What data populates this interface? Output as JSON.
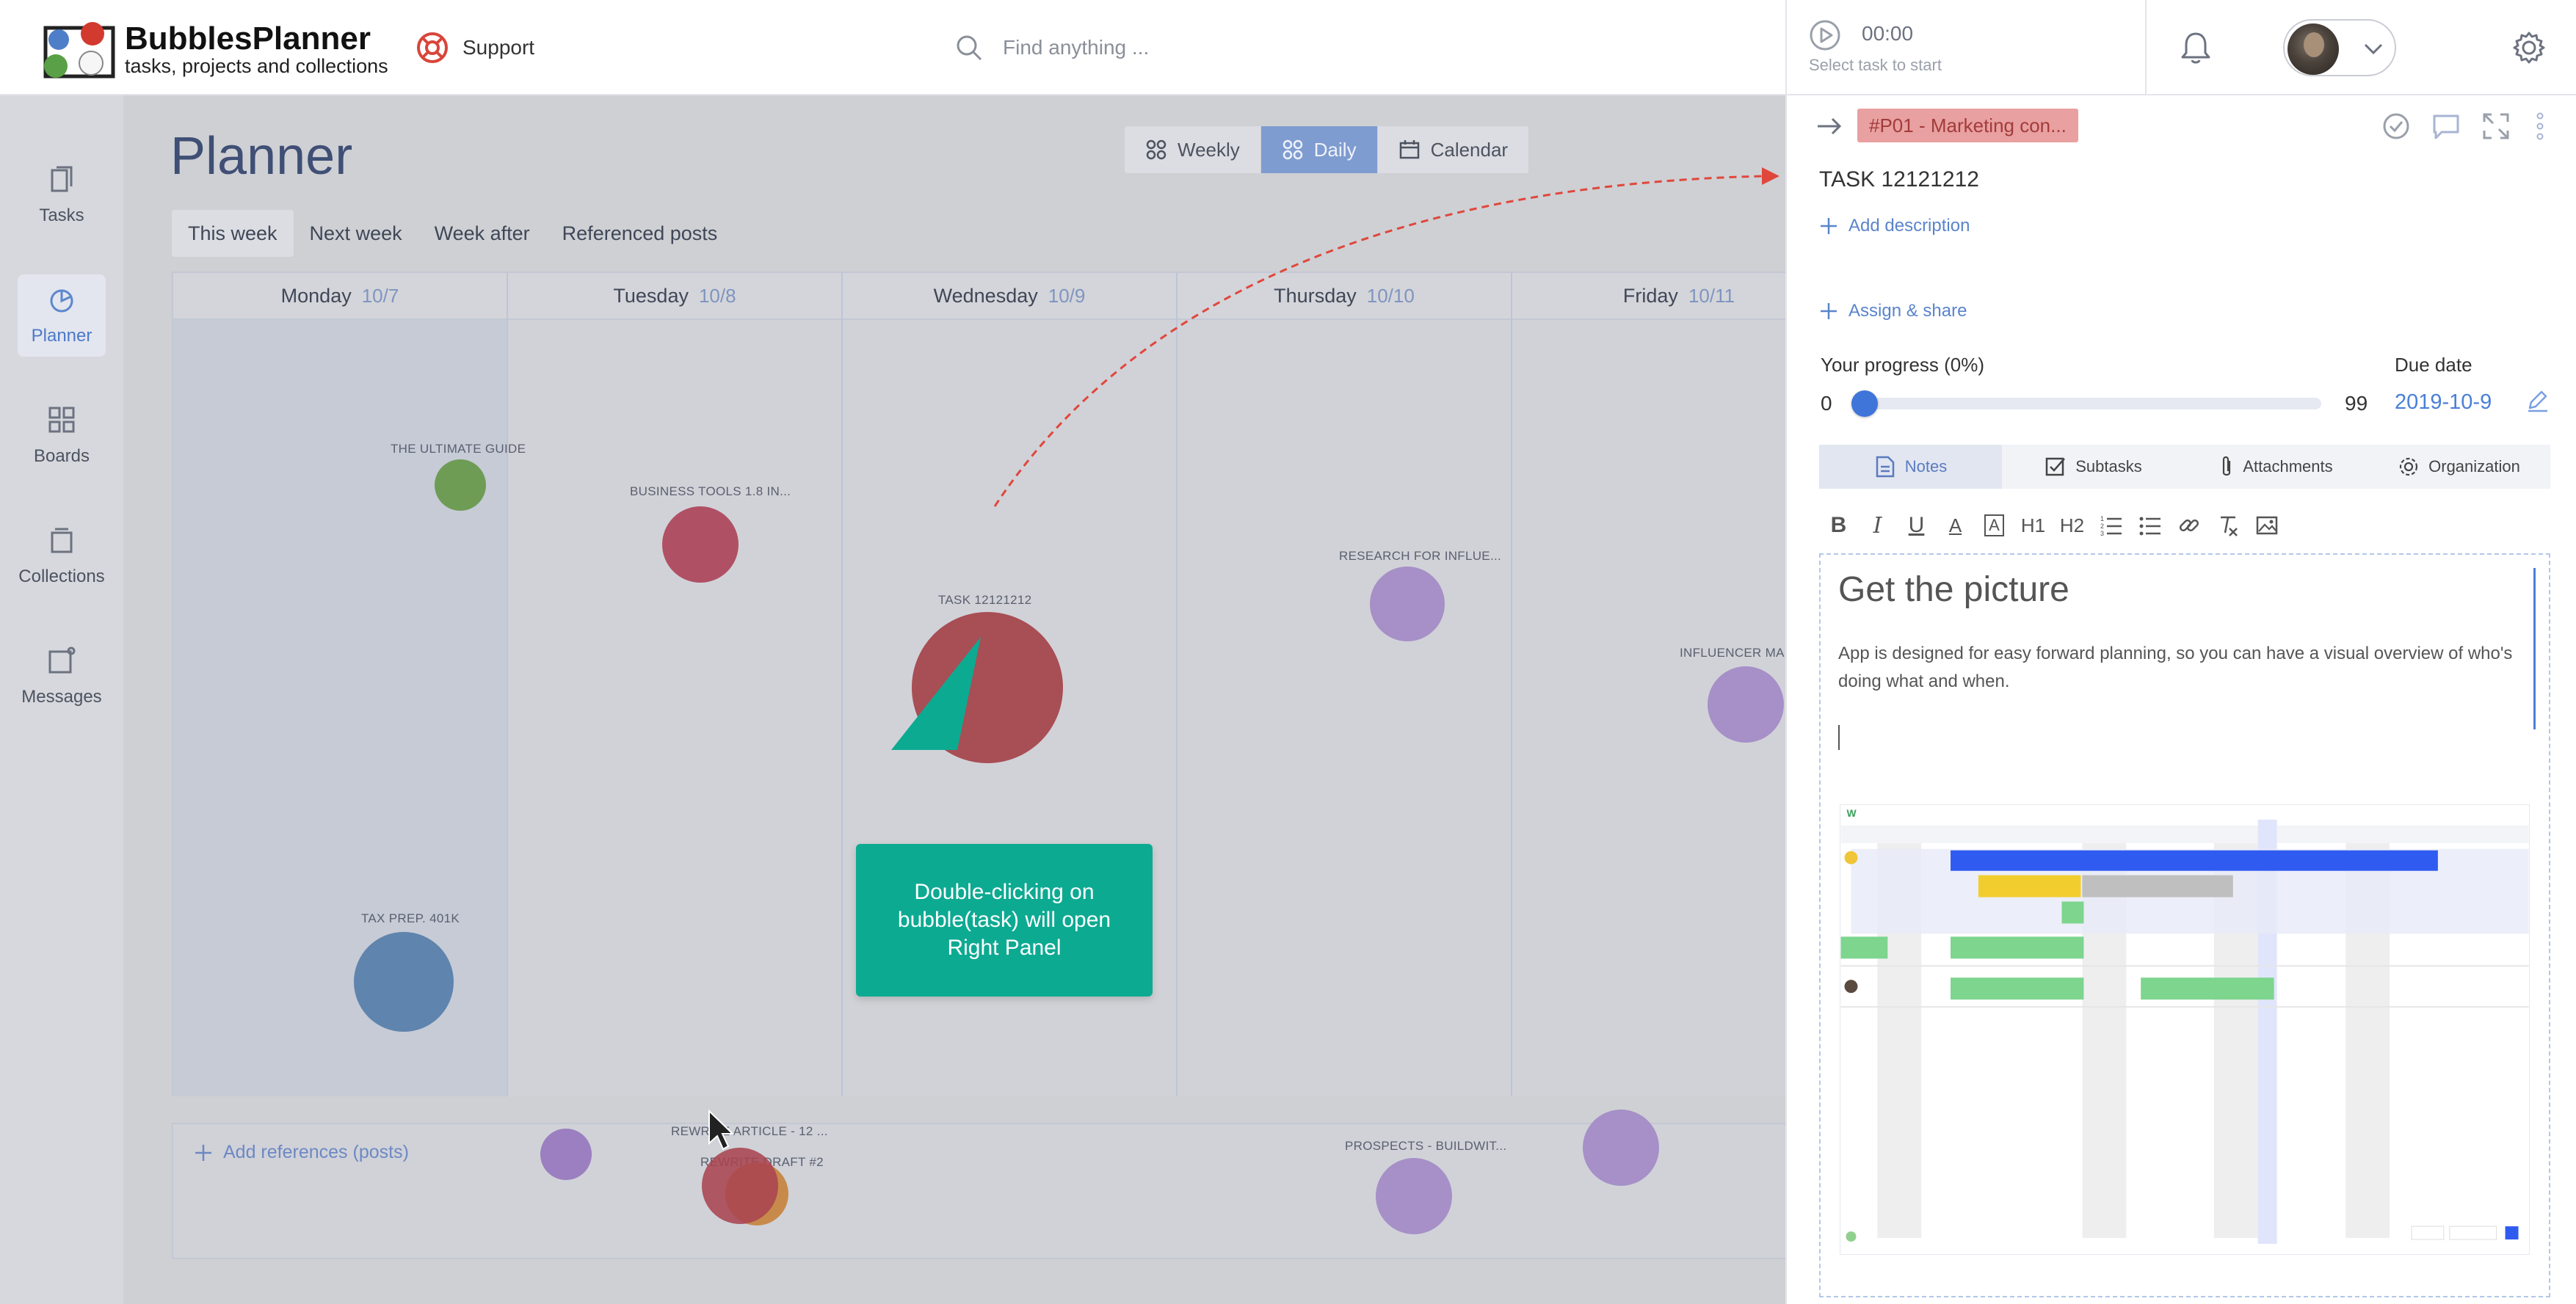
{
  "header": {
    "brand_name": "BubblesPlanner",
    "brand_tagline": "tasks, projects and collections",
    "support_label": "Support",
    "search_placeholder": "Find anything ...",
    "timer_time": "00:00",
    "timer_hint": "Select task to start"
  },
  "sidebar": {
    "items": [
      {
        "label": "Tasks",
        "icon": "tasks-icon"
      },
      {
        "label": "Planner",
        "icon": "planner-icon",
        "active": true
      },
      {
        "label": "Boards",
        "icon": "boards-icon"
      },
      {
        "label": "Collections",
        "icon": "collections-icon"
      },
      {
        "label": "Messages",
        "icon": "messages-icon"
      }
    ]
  },
  "planner": {
    "title": "Planner",
    "views": [
      {
        "label": "Weekly"
      },
      {
        "label": "Daily",
        "active": true
      },
      {
        "label": "Calendar"
      }
    ],
    "week_tabs": [
      "This week",
      "Next week",
      "Week after",
      "Referenced posts"
    ],
    "days": [
      {
        "name": "Monday",
        "date": "10/7"
      },
      {
        "name": "Tuesday",
        "date": "10/8"
      },
      {
        "name": "Wednesday",
        "date": "10/9"
      },
      {
        "name": "Thursday",
        "date": "10/10"
      },
      {
        "name": "Friday",
        "date": "10/11"
      }
    ],
    "bubble_labels": {
      "ultimate_guide": "THE ULTIMATE GUIDE",
      "business_tools": "BUSINESS TOOLS 1.8 IN...",
      "task": "TASK 12121212",
      "research": "RESEARCH FOR INFLUE...",
      "influencer": "INFLUENCER MARKE",
      "tax_prep": "TAX PREP. 401K",
      "rewrite": "REWRITE ARTICLE - 12 ...",
      "rewrite_two": "REWRITE DRAFT #2",
      "prospects": "PROSPECTS - BUILDWIT..."
    },
    "add_references": "Add references (posts)",
    "callout": "Double-clicking on bubble(task) will open Right Panel"
  },
  "panel": {
    "project_tag": "#P01 - Marketing con...",
    "task_title": "TASK 12121212",
    "add_description": "Add description",
    "assign_share": "Assign & share",
    "progress_label": "Your progress  (0%)",
    "progress_min": "0",
    "progress_max": "99",
    "progress_value": 0,
    "due_label": "Due date",
    "due_value": "2019-10-9",
    "tabs": [
      {
        "label": "Notes",
        "active": true
      },
      {
        "label": "Subtasks"
      },
      {
        "label": "Attachments"
      },
      {
        "label": "Organization"
      }
    ],
    "toolbar": [
      "B",
      "I",
      "U",
      "A",
      "A",
      "H1",
      "H2"
    ],
    "notes_heading": "Get the picture",
    "notes_body": "App is designed for easy forward planning, so you can have a visual overview of who's doing what and when."
  },
  "colors": {
    "accent": "#4a7fd8",
    "task_bubble": "#a84e55",
    "callout": "#0daa92",
    "project_tag_bg": "#e8a0a0"
  }
}
